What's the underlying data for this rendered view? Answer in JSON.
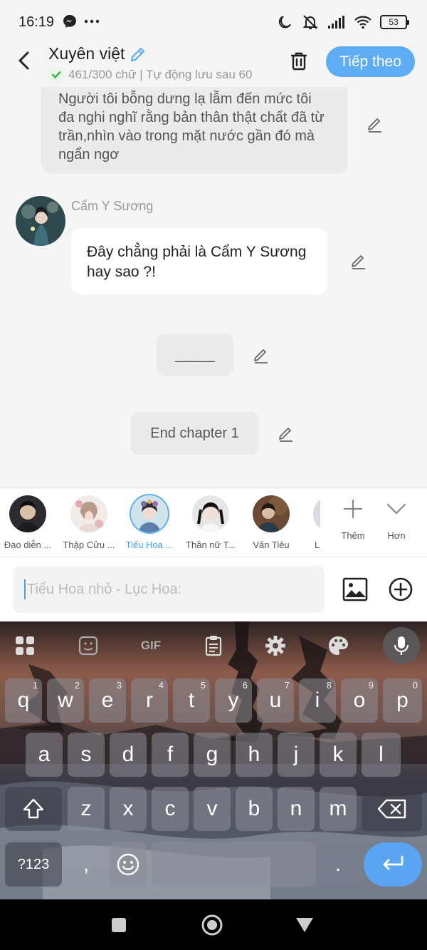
{
  "status_bar": {
    "time": "16:19",
    "battery": "53",
    "icons": [
      "messenger-icon",
      "more-dots-icon",
      "moon-icon",
      "mute-icon",
      "signal-icon",
      "wifi-icon",
      "battery-icon"
    ]
  },
  "header": {
    "title": "Xuyên việt",
    "subtitle": "461/300 chữ | Tự động lưu sau 60",
    "next_label": "Tiếp theo"
  },
  "chat": {
    "narration": "Người tôi bỗng dưng lạ lẫm đến mức tôi đa nghi nghĩ rằng bản thân thật chất đã từ trần,nhìn vào trong mặt nước gần đó mà ngẩn ngơ",
    "speaker_name": "Cẩm Y Sương",
    "speech": "Đây chẳng phải là Cẩm Y Sương hay sao ?!",
    "divider": "_____",
    "end_label": "End chapter 1"
  },
  "characters": [
    {
      "label": "Đạo diễn ...",
      "selected": false
    },
    {
      "label": "Thập Cửu ...",
      "selected": false
    },
    {
      "label": "Tiểu Hoa ...",
      "selected": true
    },
    {
      "label": "Thần nữ T...",
      "selected": false
    },
    {
      "label": "Văn Tiêu",
      "selected": false
    },
    {
      "label": "L",
      "selected": false
    }
  ],
  "char_actions": {
    "more_label": "Thêm",
    "collapse_label": "Hơn"
  },
  "input": {
    "placeholder": "Tiểu Hoa nhỏ - Lục Hoa:"
  },
  "keyboard": {
    "row1": [
      {
        "k": "q",
        "h": "1"
      },
      {
        "k": "w",
        "h": "2"
      },
      {
        "k": "e",
        "h": "3"
      },
      {
        "k": "r",
        "h": "4"
      },
      {
        "k": "t",
        "h": "5"
      },
      {
        "k": "y",
        "h": "6"
      },
      {
        "k": "u",
        "h": "7"
      },
      {
        "k": "i",
        "h": "8"
      },
      {
        "k": "o",
        "h": "9"
      },
      {
        "k": "p",
        "h": "0"
      }
    ],
    "row2": [
      "a",
      "s",
      "d",
      "f",
      "g",
      "h",
      "j",
      "k",
      "l"
    ],
    "row3": [
      "z",
      "x",
      "c",
      "v",
      "b",
      "n",
      "m"
    ],
    "symbols_label": "?123",
    "comma": ",",
    "period": ".",
    "gif_label": "GIF"
  },
  "colors": {
    "accent": "#5eadf4",
    "selected_label": "#4a9de8",
    "check": "#34b24a"
  }
}
